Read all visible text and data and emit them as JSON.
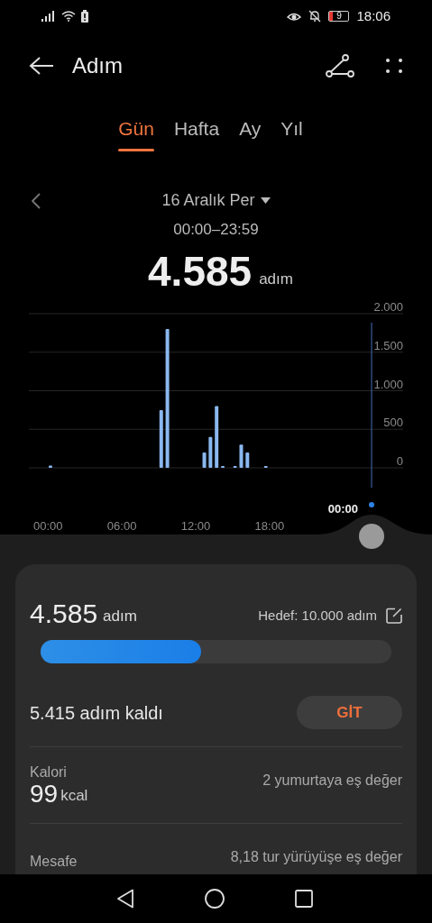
{
  "status_bar": {
    "battery": "9",
    "time": "18:06"
  },
  "header": {
    "title": "Adım"
  },
  "tabs": [
    {
      "label": "Gün",
      "selected": true
    },
    {
      "label": "Hafta",
      "selected": false
    },
    {
      "label": "Ay",
      "selected": false
    },
    {
      "label": "Yıl",
      "selected": false
    }
  ],
  "date_nav": {
    "date": "16 Aralık Per",
    "range": "00:00–23:59"
  },
  "total": {
    "value": "4.585",
    "unit": "adım"
  },
  "chart": {
    "cursor_time": "00:00",
    "chart_data": {
      "type": "bar",
      "x": [
        0.2,
        9.2,
        9.7,
        12.7,
        13.2,
        13.7,
        14.2,
        15.2,
        15.7,
        16.2,
        17.7
      ],
      "series": [
        {
          "color": "#8ab8f0",
          "values": [
            30,
            750,
            1800,
            200,
            400,
            800,
            10,
            10,
            300,
            200,
            20
          ]
        }
      ],
      "grid": true,
      "xlim": [
        -3.9,
        31.2
      ],
      "ylim": [
        0,
        2000
      ],
      "xticks": [
        {
          "value": 0,
          "label": "00:00"
        },
        {
          "value": 6,
          "label": "06:00"
        },
        {
          "value": 12,
          "label": "12:00"
        },
        {
          "value": 18,
          "label": "18:00"
        }
      ],
      "yticks": [
        {
          "value": 0,
          "label": "0"
        },
        {
          "value": 500,
          "label": "500"
        },
        {
          "value": 1000,
          "label": "1.000"
        },
        {
          "value": 1500,
          "label": "1.500"
        },
        {
          "value": 2000,
          "label": "2.000"
        }
      ]
    }
  },
  "summary": {
    "value": "4.585",
    "unit": "adım",
    "goal": "Hedef: 10.000 adım",
    "level": 0.4585,
    "remaining": "5.415 adım kaldı",
    "button": "GİT"
  },
  "metrics": [
    {
      "label": "Kalori",
      "value": "99",
      "unit": "kcal",
      "equivalent": "2 yumurtaya eş değer"
    },
    {
      "label": "Mesafe",
      "equivalent": "8,18 tur yürüyüşe eş değer"
    }
  ]
}
